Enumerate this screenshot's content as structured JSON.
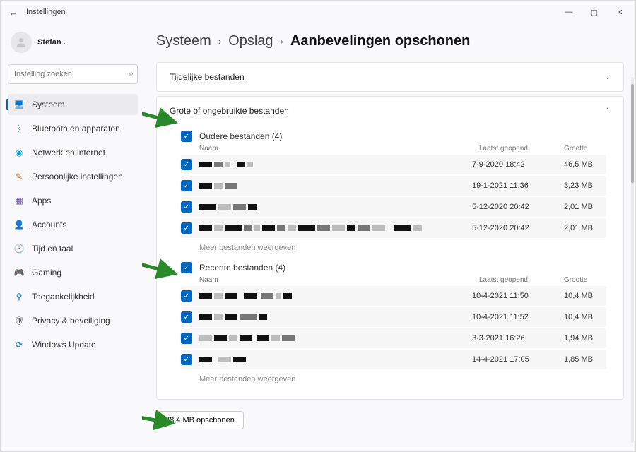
{
  "titlebar": {
    "title": "Instellingen"
  },
  "profile": {
    "name": "Stefan ."
  },
  "search": {
    "placeholder": "Instelling zoeken"
  },
  "sidebar": {
    "items": [
      {
        "label": "Systeem",
        "icon": "monitor-icon",
        "color": "c-blue",
        "active": true
      },
      {
        "label": "Bluetooth en apparaten",
        "icon": "bluetooth-icon",
        "color": "c-blue",
        "active": false
      },
      {
        "label": "Netwerk en internet",
        "icon": "wifi-icon",
        "color": "c-cyan",
        "active": false
      },
      {
        "label": "Persoonlijke instellingen",
        "icon": "brush-icon",
        "color": "c-orange",
        "active": false
      },
      {
        "label": "Apps",
        "icon": "apps-icon",
        "color": "c-purple",
        "active": false
      },
      {
        "label": "Accounts",
        "icon": "account-icon",
        "color": "c-teal",
        "active": false
      },
      {
        "label": "Tijd en taal",
        "icon": "clock-icon",
        "color": "c-gold",
        "active": false
      },
      {
        "label": "Gaming",
        "icon": "game-icon",
        "color": "c-grey",
        "active": false
      },
      {
        "label": "Toegankelijkheid",
        "icon": "accessibility-icon",
        "color": "c-blue",
        "active": false
      },
      {
        "label": "Privacy & beveiliging",
        "icon": "shield-icon",
        "color": "c-grey",
        "active": false
      },
      {
        "label": "Windows Update",
        "icon": "update-icon",
        "color": "c-blue",
        "active": false
      }
    ]
  },
  "breadcrumb": {
    "l1": "Systeem",
    "l2": "Opslag",
    "current": "Aanbevelingen opschonen"
  },
  "cards": {
    "temp": {
      "title": "Tijdelijke bestanden"
    },
    "large": {
      "title": "Grote of ongebruikte bestanden",
      "group1": {
        "title": "Oudere bestanden (4)",
        "cols": {
          "name": "Naam",
          "date": "Laatst geopend",
          "size": "Grootte"
        },
        "rows": [
          {
            "date": "7-9-2020 18:42",
            "size": "46,5 MB"
          },
          {
            "date": "19-1-2021 11:36",
            "size": "3,23 MB"
          },
          {
            "date": "5-12-2020 20:42",
            "size": "2,01 MB"
          },
          {
            "date": "5-12-2020 20:42",
            "size": "2,01 MB"
          }
        ],
        "more": "Meer bestanden weergeven"
      },
      "group2": {
        "title": "Recente bestanden (4)",
        "cols": {
          "name": "Naam",
          "date": "Laatst geopend",
          "size": "Grootte"
        },
        "rows": [
          {
            "date": "10-4-2021 11:50",
            "size": "10,4 MB"
          },
          {
            "date": "10-4-2021 11:52",
            "size": "10,4 MB"
          },
          {
            "date": "3-3-2021 16:26",
            "size": "1,94 MB"
          },
          {
            "date": "14-4-2021 17:05",
            "size": "1,85 MB"
          }
        ],
        "more": "Meer bestanden weergeven"
      }
    }
  },
  "cleanup": {
    "label": "78,4 MB opschonen"
  }
}
